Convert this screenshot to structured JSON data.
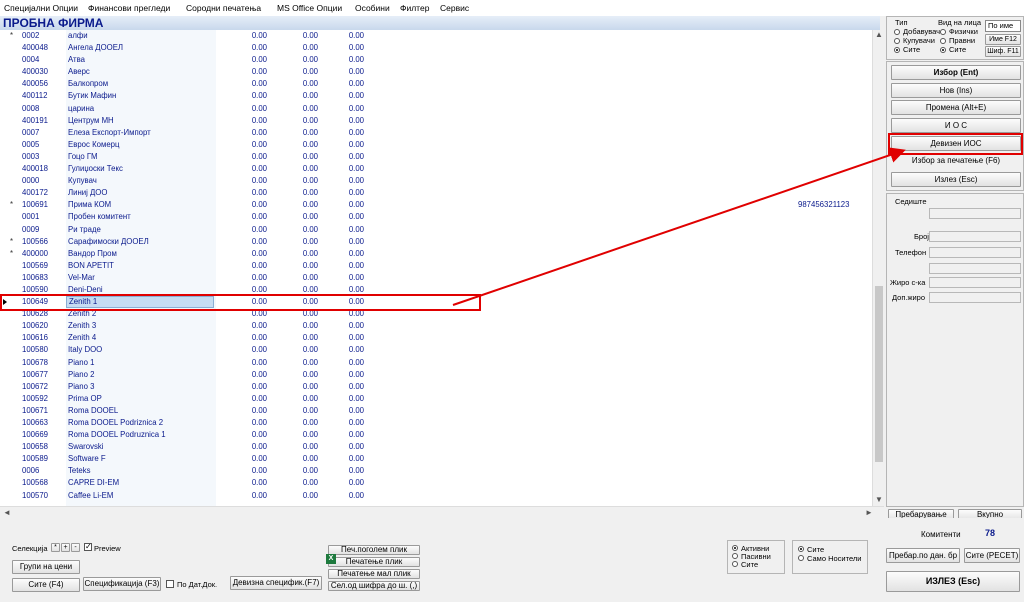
{
  "menu": [
    "Специјални Опции",
    "Финансови прегледи",
    "Сородни печатења",
    "MS Office Опции",
    "Особини",
    "Филтер",
    "Сервис"
  ],
  "title": "ПРОБНА ФИРМА",
  "rows": [
    {
      "mark": "*",
      "code": "0002",
      "name": "алфи",
      "v1": "0.00",
      "v2": "0.00",
      "v3": "0.00",
      "extra": ""
    },
    {
      "mark": "",
      "code": "400048",
      "name": "Ангела ДООЕЛ",
      "v1": "0.00",
      "v2": "0.00",
      "v3": "0.00",
      "extra": ""
    },
    {
      "mark": "",
      "code": "0004",
      "name": "Атва",
      "v1": "0.00",
      "v2": "0.00",
      "v3": "0.00",
      "extra": ""
    },
    {
      "mark": "",
      "code": "400030",
      "name": "Аверс",
      "v1": "0.00",
      "v2": "0.00",
      "v3": "0.00",
      "extra": ""
    },
    {
      "mark": "",
      "code": "400056",
      "name": "Балкопром",
      "v1": "0.00",
      "v2": "0.00",
      "v3": "0.00",
      "extra": ""
    },
    {
      "mark": "",
      "code": "400112",
      "name": "Бутик Мафин",
      "v1": "0.00",
      "v2": "0.00",
      "v3": "0.00",
      "extra": ""
    },
    {
      "mark": "",
      "code": "0008",
      "name": "царина",
      "v1": "0.00",
      "v2": "0.00",
      "v3": "0.00",
      "extra": ""
    },
    {
      "mark": "",
      "code": "400191",
      "name": "Центрум МН",
      "v1": "0.00",
      "v2": "0.00",
      "v3": "0.00",
      "extra": ""
    },
    {
      "mark": "",
      "code": "0007",
      "name": "Елеза Експорт-Импорт",
      "v1": "0.00",
      "v2": "0.00",
      "v3": "0.00",
      "extra": ""
    },
    {
      "mark": "",
      "code": "0005",
      "name": "Еврос Комерц",
      "v1": "0.00",
      "v2": "0.00",
      "v3": "0.00",
      "extra": ""
    },
    {
      "mark": "",
      "code": "0003",
      "name": "Гоцо ГМ",
      "v1": "0.00",
      "v2": "0.00",
      "v3": "0.00",
      "extra": ""
    },
    {
      "mark": "",
      "code": "400018",
      "name": "Гулиџоски Текс",
      "v1": "0.00",
      "v2": "0.00",
      "v3": "0.00",
      "extra": ""
    },
    {
      "mark": "",
      "code": "0000",
      "name": "Купувач",
      "v1": "0.00",
      "v2": "0.00",
      "v3": "0.00",
      "extra": ""
    },
    {
      "mark": "",
      "code": "400172",
      "name": "Линиј ДОО",
      "v1": "0.00",
      "v2": "0.00",
      "v3": "0.00",
      "extra": ""
    },
    {
      "mark": "*",
      "code": "100691",
      "name": "Прима КОМ",
      "v1": "0.00",
      "v2": "0.00",
      "v3": "0.00",
      "extra": "987456321123"
    },
    {
      "mark": "",
      "code": "0001",
      "name": "Пробен комитент",
      "v1": "0.00",
      "v2": "0.00",
      "v3": "0.00",
      "extra": ""
    },
    {
      "mark": "",
      "code": "0009",
      "name": "Ри траде",
      "v1": "0.00",
      "v2": "0.00",
      "v3": "0.00",
      "extra": ""
    },
    {
      "mark": "*",
      "code": "100566",
      "name": "Сарафимоски ДООЕЛ",
      "v1": "0.00",
      "v2": "0.00",
      "v3": "0.00",
      "extra": ""
    },
    {
      "mark": "*",
      "code": "400000",
      "name": "Вандор Пром",
      "v1": "0.00",
      "v2": "0.00",
      "v3": "0.00",
      "extra": ""
    },
    {
      "mark": "",
      "code": "100569",
      "name": "BON APETIT",
      "v1": "0.00",
      "v2": "0.00",
      "v3": "0.00",
      "extra": ""
    },
    {
      "mark": "",
      "code": "100683",
      "name": "Vel-Mar",
      "v1": "0.00",
      "v2": "0.00",
      "v3": "0.00",
      "extra": ""
    },
    {
      "mark": "",
      "code": "100590",
      "name": "Deni-Deni",
      "v1": "0.00",
      "v2": "0.00",
      "v3": "0.00",
      "extra": ""
    },
    {
      "mark": "",
      "code": "100649",
      "name": "Zenith 1",
      "v1": "0.00",
      "v2": "0.00",
      "v3": "0.00",
      "extra": ""
    },
    {
      "mark": "",
      "code": "100628",
      "name": "Zenith 2",
      "v1": "0.00",
      "v2": "0.00",
      "v3": "0.00",
      "extra": ""
    },
    {
      "mark": "",
      "code": "100620",
      "name": "Zenith 3",
      "v1": "0.00",
      "v2": "0.00",
      "v3": "0.00",
      "extra": ""
    },
    {
      "mark": "",
      "code": "100616",
      "name": "Zenith 4",
      "v1": "0.00",
      "v2": "0.00",
      "v3": "0.00",
      "extra": ""
    },
    {
      "mark": "",
      "code": "100580",
      "name": "Italy DOO",
      "v1": "0.00",
      "v2": "0.00",
      "v3": "0.00",
      "extra": ""
    },
    {
      "mark": "",
      "code": "100678",
      "name": "Piano 1",
      "v1": "0.00",
      "v2": "0.00",
      "v3": "0.00",
      "extra": ""
    },
    {
      "mark": "",
      "code": "100677",
      "name": "Piano 2",
      "v1": "0.00",
      "v2": "0.00",
      "v3": "0.00",
      "extra": ""
    },
    {
      "mark": "",
      "code": "100672",
      "name": "Piano 3",
      "v1": "0.00",
      "v2": "0.00",
      "v3": "0.00",
      "extra": ""
    },
    {
      "mark": "",
      "code": "100592",
      "name": "Prima OP",
      "v1": "0.00",
      "v2": "0.00",
      "v3": "0.00",
      "extra": ""
    },
    {
      "mark": "",
      "code": "100671",
      "name": "Roma DOOEL",
      "v1": "0.00",
      "v2": "0.00",
      "v3": "0.00",
      "extra": ""
    },
    {
      "mark": "",
      "code": "100663",
      "name": "Roma DOOEL Podriznica 2",
      "v1": "0.00",
      "v2": "0.00",
      "v3": "0.00",
      "extra": ""
    },
    {
      "mark": "",
      "code": "100669",
      "name": "Roma DOOEL Podruznica 1",
      "v1": "0.00",
      "v2": "0.00",
      "v3": "0.00",
      "extra": ""
    },
    {
      "mark": "",
      "code": "100658",
      "name": "Swarovski",
      "v1": "0.00",
      "v2": "0.00",
      "v3": "0.00",
      "extra": ""
    },
    {
      "mark": "",
      "code": "100589",
      "name": "Software F",
      "v1": "0.00",
      "v2": "0.00",
      "v3": "0.00",
      "extra": ""
    },
    {
      "mark": "",
      "code": "0006",
      "name": "Teteks",
      "v1": "0.00",
      "v2": "0.00",
      "v3": "0.00",
      "extra": ""
    },
    {
      "mark": "",
      "code": "100568",
      "name": "CAPRE DI-EM",
      "v1": "0.00",
      "v2": "0.00",
      "v3": "0.00",
      "extra": ""
    },
    {
      "mark": "",
      "code": "100570",
      "name": "Caffee Li-EM",
      "v1": "0.00",
      "v2": "0.00",
      "v3": "0.00",
      "extra": ""
    }
  ],
  "selected_row": 22,
  "filter": {
    "tip_label": "Тип",
    "tip_options": [
      "Добавувач",
      "Купувачи",
      "Сите"
    ],
    "tip_selected": 2,
    "vid_label": "Вид на лица",
    "vid_options": [
      "Физички",
      "Правни",
      "Сите"
    ],
    "vid_selected": 2,
    "by_name_label": "По име",
    "name_btn": "Име F12",
    "code_btn": "Шиф. F11"
  },
  "actions": {
    "izbor": "Избор (Ent)",
    "nov": "Нов (Ins)",
    "promena": "Промена (Alt+E)",
    "ios": "И О С",
    "deviz_ios": "Девизен ИОС",
    "izbor_pecatenje": "Избор за печатење (F6)",
    "izlez": "Излез (Esc)"
  },
  "details": {
    "sediste": "Седиште",
    "broj": "Број",
    "telefon": "Телефон",
    "ziro": "Жиро с-ка",
    "dop_ziro": "Доп.жиро"
  },
  "right_tabs": {
    "prebaruvanje": "Пребарување",
    "vkupno": "Вкупно"
  },
  "bottom": {
    "selekcija": "Селекција",
    "preview": "Preview",
    "grupi_ceni": "Групи на цени",
    "site": "Сите (F4)",
    "specifikacija": "Спецификација (F3)",
    "po_dat_dok": "По Дат.Док.",
    "devizna_spec": "Девизна специфик.(F7)",
    "pec_pogolem": "Печ.поголем плик",
    "pecatenje_plik": "Печатење плик",
    "pecatenje_mal": "Печатење мал плик",
    "sel_od_sifra": "Сел.од шифра до ш. (,)",
    "status_options": [
      "Активни",
      "Пасивни",
      "Сите"
    ],
    "status_selected": 0,
    "nositeli_options": [
      "Сите",
      "Само Носители"
    ],
    "nositeli_selected": 0,
    "komitenti_label": "Комитенти",
    "komitenti_count": "78",
    "prebar_dan": "Пребар.по дан. бр",
    "site_reset": "Сите (РЕСЕТ)",
    "izlez": "ИЗЛЕЗ   (Esc)"
  }
}
